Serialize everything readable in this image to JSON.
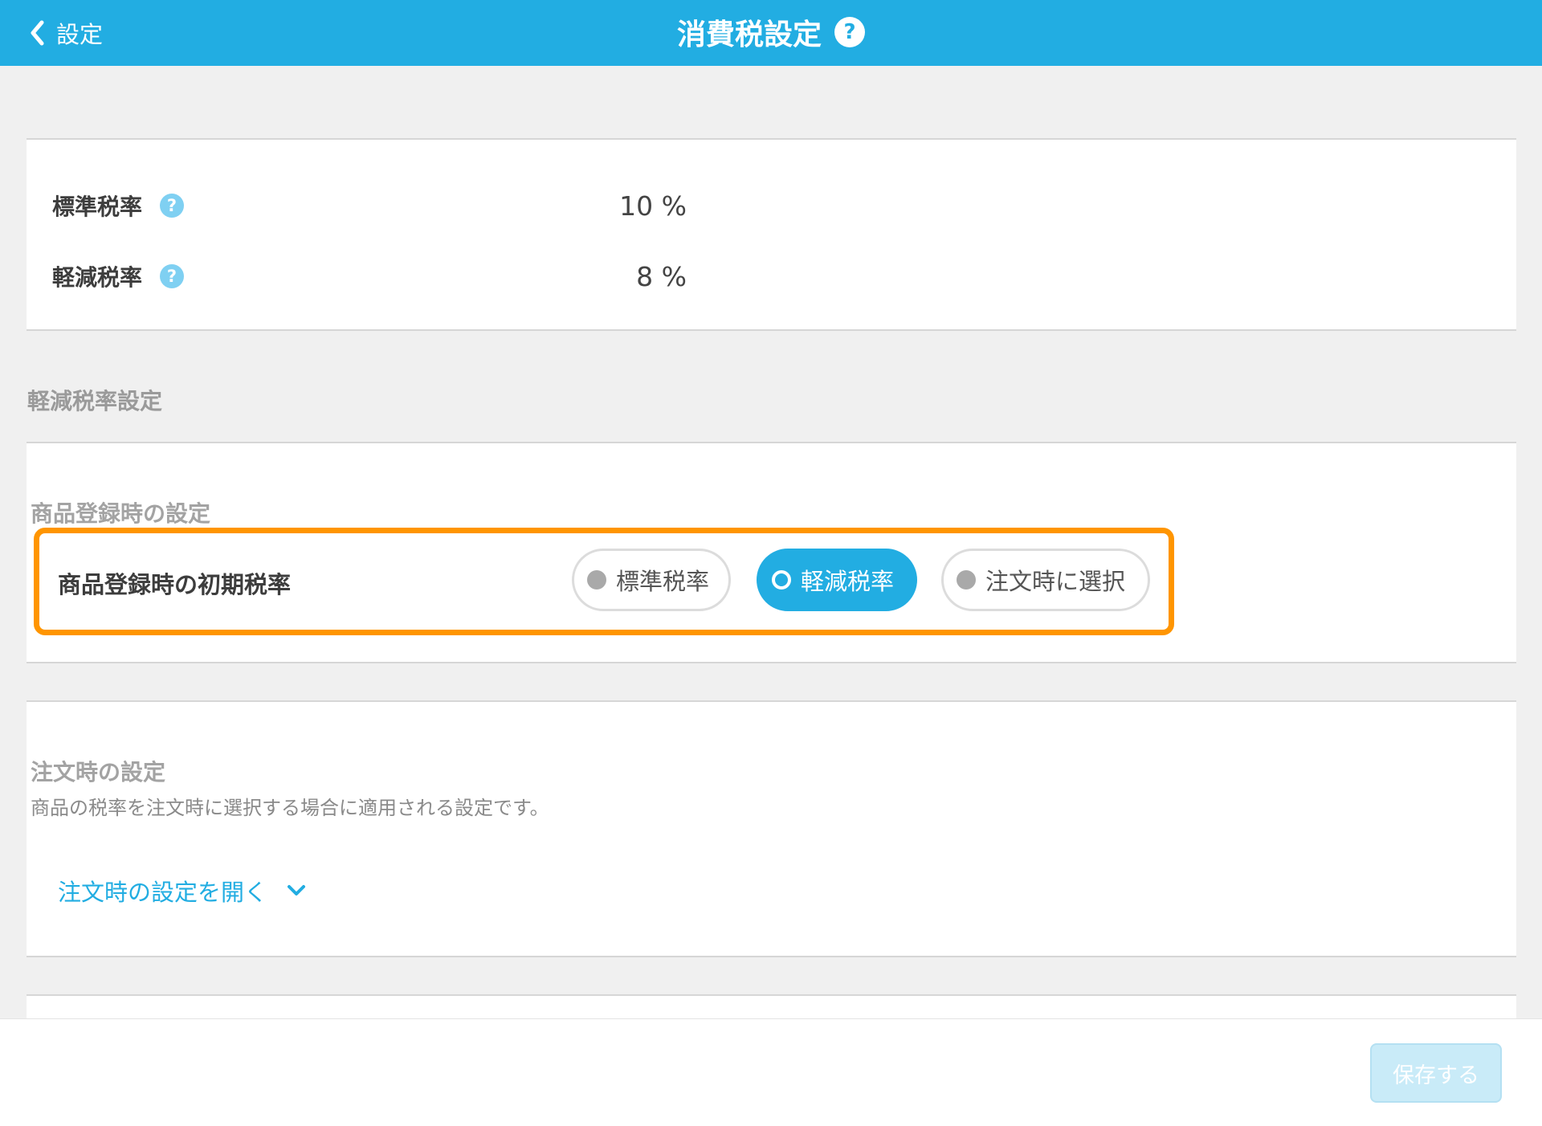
{
  "header": {
    "back_label": "設定",
    "title": "消費税設定",
    "help_icon_glyph": "?"
  },
  "rates": [
    {
      "label": "標準税率",
      "help_icon_glyph": "?",
      "value": "10 %"
    },
    {
      "label": "軽減税率",
      "help_icon_glyph": "?",
      "value": "8 %"
    }
  ],
  "reduced_section": {
    "heading": "軽減税率設定",
    "product_settings": {
      "subheading": "商品登録時の設定",
      "initial_rate_label": "商品登録時の初期税率",
      "options": [
        "標準税率",
        "軽減税率",
        "注文時に選択"
      ],
      "selected_index": 1
    }
  },
  "order_section": {
    "subheading": "注文時の設定",
    "description": "商品の税率を注文時に選択する場合に適用される設定です。",
    "open_link": "注文時の設定を開く"
  },
  "footer": {
    "save_label": "保存する"
  },
  "colors": {
    "header_bg": "#22ade2",
    "accent": "#22ade2",
    "highlight": "#ff9500",
    "save_disabled_bg": "#c9ebf8"
  }
}
